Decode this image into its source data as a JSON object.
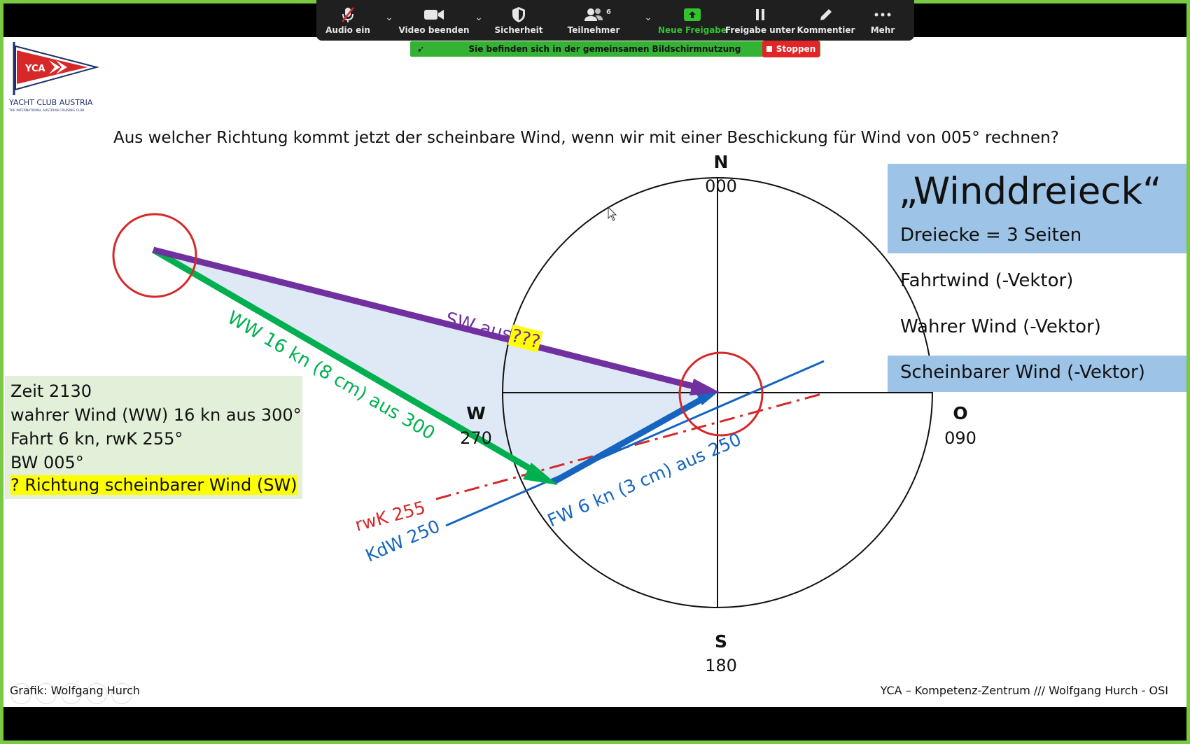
{
  "toolbar": {
    "audio": "Audio ein",
    "video": "Video beenden",
    "security": "Sicherheit",
    "participants": "Teilnehmer",
    "participant_count": "6",
    "new_share": "Neue Freigabe",
    "pause_share": "Freigabe unter",
    "annotate": "Kommentier",
    "more": "Mehr"
  },
  "share_banner": {
    "text": "Sie befinden sich in der gemeinsamen Bildschirmnutzung",
    "stop": "Stoppen"
  },
  "logo": {
    "flag_text": "YCA",
    "name": "YACHT CLUB AUSTRIA",
    "tagline": "THE INTERNATIONAL AUSTRIAN CRUISING CLUB"
  },
  "question": "Aus welcher Richtung kommt jetzt der scheinbare Wind, wenn wir mit einer Beschickung für Wind von 005° rechnen?",
  "compass": {
    "north_letter": "N",
    "north_deg": "000",
    "east_letter": "O",
    "east_deg": "090",
    "south_letter": "S",
    "south_deg": "180",
    "west_letter": "W",
    "west_deg": "270"
  },
  "vector_labels": {
    "sw_prefix": "SW aus",
    "sw_unknown": "???",
    "ww": "WW 16 kn (8 cm) aus 300",
    "fw": "FW 6 kn (3 cm) aus 250",
    "rwk": "rwK 255",
    "kdw": "KdW 250"
  },
  "info": {
    "line1": "Zeit 2130",
    "line2": "wahrer Wind (WW) 16 kn aus 300°",
    "line3": "Fahrt 6 kn, rwK 255°",
    "line4": "BW 005°",
    "line5": "? Richtung scheinbarer Wind (SW)"
  },
  "legend": {
    "title": "„Winddreieck“",
    "subtitle": "Dreiecke = 3 Seiten",
    "item1": "Fahrtwind (-Vektor)",
    "item2": "Wahrer Wind (-Vektor)",
    "item3": "Scheinbarer Wind (-Vektor)"
  },
  "footer": {
    "left": "Grafik: Wolfgang Hurch",
    "right": "YCA – Kompetenz-Zentrum  ///  Wolfgang Hurch - OSI"
  },
  "colors": {
    "accent_green": "#7ac943",
    "sw_purple": "#7030a0",
    "ww_green": "#00b050",
    "fw_blue": "#1565c0",
    "rwk_red": "#d62828",
    "legend_blue": "#9dc3e6",
    "info_green": "#e2efd9"
  }
}
